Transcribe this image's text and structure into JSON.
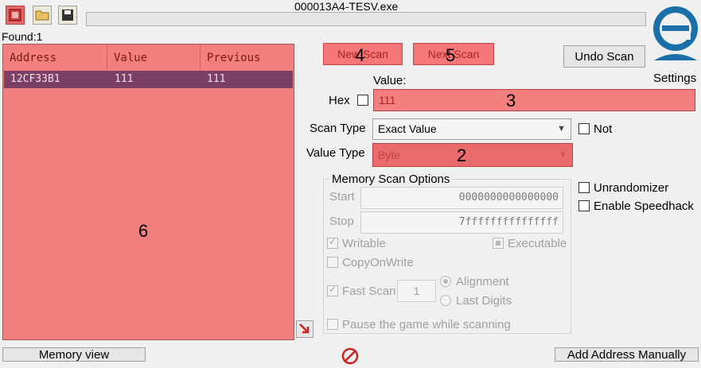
{
  "window": {
    "title": "000013A4-TESV.exe"
  },
  "toolbar": {
    "open_process_icon": "process-select-icon",
    "open_icon": "folder-open-icon",
    "save_icon": "save-icon"
  },
  "found_label": "Found:1",
  "results": {
    "columns": [
      "Address",
      "Value",
      "Previous"
    ],
    "rows": [
      {
        "address": "12CF33B1",
        "value": "111",
        "previous": "111"
      }
    ],
    "overlay_number": "6"
  },
  "scan": {
    "new_scan_label": "New Scan",
    "new_scan_overlay": "4",
    "next_scan_label": "Next Scan",
    "next_scan_overlay": "5",
    "undo_scan_label": "Undo Scan",
    "settings_label": "Settings",
    "value_label": "Value:",
    "hex_label": "Hex",
    "value": "111",
    "value_overlay": "3",
    "scan_type_label": "Scan Type",
    "scan_type_value": "Exact Value",
    "not_label": "Not",
    "value_type_label": "Value Type",
    "value_type_value": "Byte",
    "value_type_overlay": "2"
  },
  "memory_options": {
    "title": "Memory Scan Options",
    "start_label": "Start",
    "start_value": "0000000000000000",
    "stop_label": "Stop",
    "stop_value": "7fffffffffffffff",
    "writable_label": "Writable",
    "executable_label": "Executable",
    "copyonwrite_label": "CopyOnWrite",
    "fast_scan_label": "Fast Scan",
    "fast_scan_value": "1",
    "alignment_label": "Alignment",
    "last_digits_label": "Last Digits",
    "pause_label": "Pause the game while scanning"
  },
  "extra_options": {
    "unrandomizer_label": "Unrandomizer",
    "speedhack_label": "Enable Speedhack"
  },
  "bottom": {
    "memory_view_label": "Memory view",
    "add_address_label": "Add Address Manually"
  },
  "colors": {
    "highlight_red": "#f47f7f",
    "selected_row": "#7c3f66",
    "logo_blue": "#1a6fa8"
  }
}
